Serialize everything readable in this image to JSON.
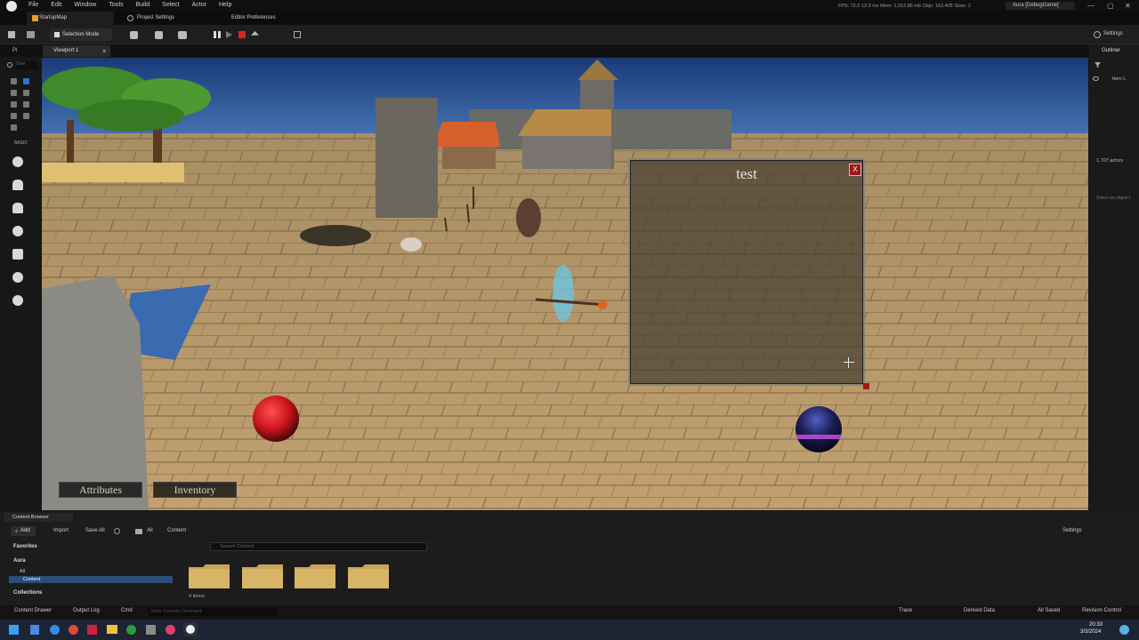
{
  "titlebar": {
    "menus": [
      "File",
      "Edit",
      "Window",
      "Tools",
      "Build",
      "Select",
      "Actor",
      "Help"
    ],
    "stats": "FPS: 72.0   13.9 ms   Mem: 1,913.86 mb   Objs: 162,405   Stats: 2",
    "app_name": "Aura [DebugGame]",
    "win_min": "—",
    "win_max": "▢",
    "win_close": "✕"
  },
  "doc_tabs": [
    "StartupMap",
    "Project Settings",
    "Editor Preferences"
  ],
  "toolbar": {
    "selection_mode": "Selection Mode",
    "settings": "Settings"
  },
  "viewport": {
    "tab_label": "Viewport 1",
    "close": "×"
  },
  "left_panel": {
    "search_placeholder": "Sear",
    "section_label": "BASIC",
    "panel_tab": "Pl"
  },
  "game_ui": {
    "window_title": "test",
    "close_button": "X",
    "attributes_button": "Attributes",
    "inventory_button": "Inventory",
    "health_orb_color": "#c8141c",
    "mana_orb_color": "#6a2ad0"
  },
  "outliner": {
    "title": "Outliner",
    "item": "Item L",
    "actors_count": "1,707 actors",
    "details_hint": "Select an object t"
  },
  "content_browser": {
    "tab_label": "Content Browser",
    "add": "Add",
    "import": "Import",
    "save_all": "Save All",
    "path": [
      "All",
      "Content"
    ],
    "settings": "Settings",
    "favorites": "Favorites",
    "project": "Aura",
    "tree": [
      "All",
      "Content"
    ],
    "collections": "Collections",
    "search_placeholder": "Search Content",
    "items_count": "4 items",
    "folder_color": "#c9a458"
  },
  "statusbar": {
    "content_drawer": "Content Drawer",
    "output_log": "Output Log",
    "cmd": "Cmd",
    "console_placeholder": "Enter Console Command",
    "trace": "Trace",
    "derived_data": "Derived Data",
    "all_saved": "All Saved",
    "revision_control": "Revision Control"
  },
  "taskbar": {
    "time": "20:33",
    "date": "3/3/2024"
  }
}
